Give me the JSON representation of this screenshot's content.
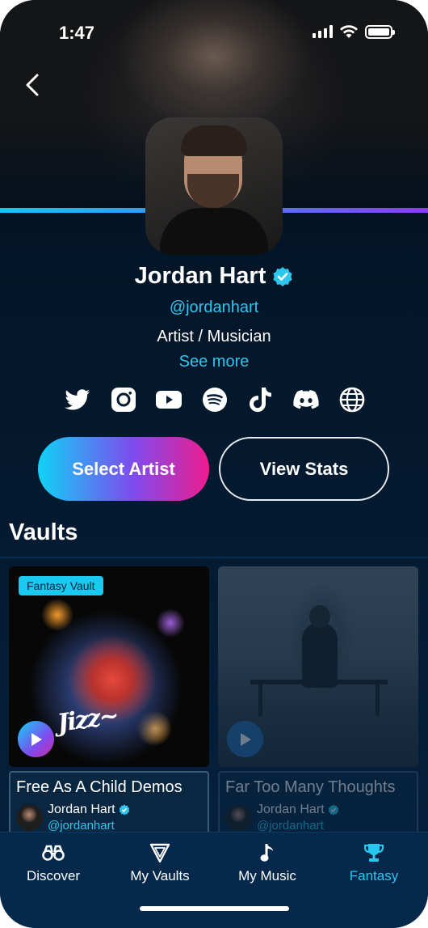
{
  "status_bar": {
    "time": "1:47"
  },
  "artist": {
    "name": "Jordan Hart",
    "handle": "@jordanhart",
    "role": "Artist / Musician",
    "see_more": "See more",
    "verified": true
  },
  "socials": [
    "twitter-icon",
    "instagram-icon",
    "youtube-icon",
    "spotify-icon",
    "tiktok-icon",
    "discord-icon",
    "website-icon"
  ],
  "actions": {
    "select_artist": "Select Artist",
    "view_stats": "View Stats"
  },
  "vaults": {
    "title": "Vaults",
    "items": [
      {
        "tag": "Fantasy Vault",
        "title": "Free As A Child Demos",
        "artist": "Jordan Hart",
        "handle": "@jordanhart",
        "active": true
      },
      {
        "tag": "",
        "title": "Far Too Many Thoughts",
        "artist": "Jordan Hart",
        "handle": "@jordanhart",
        "active": false
      }
    ]
  },
  "tabs": [
    {
      "label": "Discover",
      "icon": "binoculars-icon",
      "active": false
    },
    {
      "label": "My Vaults",
      "icon": "vault-icon",
      "active": false
    },
    {
      "label": "My Music",
      "icon": "music-note-icon",
      "active": false
    },
    {
      "label": "Fantasy",
      "icon": "trophy-icon",
      "active": true
    }
  ],
  "colors": {
    "accent": "#2fc6ee",
    "background": "#02101f",
    "gradient_start": "#10d2f5",
    "gradient_end": "#ee1c8e"
  }
}
